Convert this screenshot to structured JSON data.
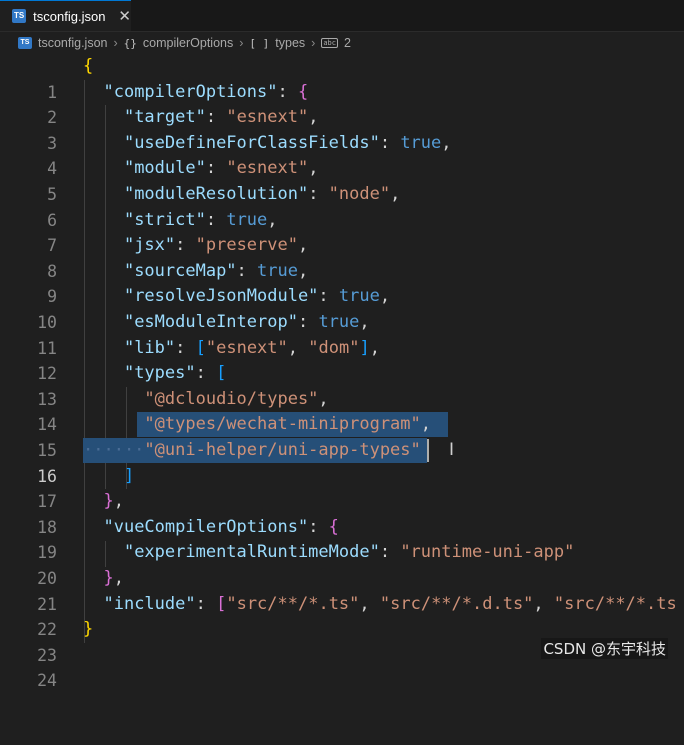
{
  "tab": {
    "filename": "tsconfig.json",
    "close": "✕",
    "badge": "TS"
  },
  "breadcrumb": {
    "file": "tsconfig.json",
    "obj_glyph": "{}",
    "section": "compilerOptions",
    "arr_glyph": "[ ]",
    "key": "types",
    "count_icon": "abc",
    "count": "2"
  },
  "lines": [
    {
      "n": "1"
    },
    {
      "n": "2"
    },
    {
      "n": "3"
    },
    {
      "n": "4"
    },
    {
      "n": "5"
    },
    {
      "n": "6"
    },
    {
      "n": "7"
    },
    {
      "n": "8"
    },
    {
      "n": "9"
    },
    {
      "n": "10"
    },
    {
      "n": "11"
    },
    {
      "n": "12"
    },
    {
      "n": "13"
    },
    {
      "n": "14"
    },
    {
      "n": "15"
    },
    {
      "n": "16"
    },
    {
      "n": "17"
    },
    {
      "n": "18"
    },
    {
      "n": "19"
    },
    {
      "n": "20"
    },
    {
      "n": "21"
    },
    {
      "n": "22"
    },
    {
      "n": "23"
    },
    {
      "n": "24"
    }
  ],
  "code": {
    "l2_key": "\"compilerOptions\"",
    "l3_key": "\"target\"",
    "l3_val": "\"esnext\"",
    "l4_key": "\"useDefineForClassFields\"",
    "l4_val": "true",
    "l5_key": "\"module\"",
    "l5_val": "\"esnext\"",
    "l6_key": "\"moduleResolution\"",
    "l6_val": "\"node\"",
    "l7_key": "\"strict\"",
    "l7_val": "true",
    "l8_key": "\"jsx\"",
    "l8_val": "\"preserve\"",
    "l9_key": "\"sourceMap\"",
    "l9_val": "true",
    "l10_key": "\"resolveJsonModule\"",
    "l10_val": "true",
    "l11_key": "\"esModuleInterop\"",
    "l11_val": "true",
    "l12_key": "\"lib\"",
    "l12_val1": "\"esnext\"",
    "l12_val2": "\"dom\"",
    "l13_key": "\"types\"",
    "l14_val": "\"@dcloudio/types\"",
    "l15_val": "\"@types/wechat-miniprogram\"",
    "l16_val": "\"@uni-helper/uni-app-types\"",
    "l19_key": "\"vueCompilerOptions\"",
    "l20_key": "\"experimentalRuntimeMode\"",
    "l20_val": "\"runtime-uni-app\"",
    "l22_key": "\"include\"",
    "l22_val1": "\"src/**/*.ts\"",
    "l22_val2": "\"src/**/*.d.ts\"",
    "l22_val3": "\"src/**/*.ts"
  },
  "watermark": "CSDN @东宇科技",
  "colors": {
    "key": "#9cdcfe",
    "string": "#ce9178",
    "bool": "#569cd6",
    "selection": "#264f78"
  }
}
